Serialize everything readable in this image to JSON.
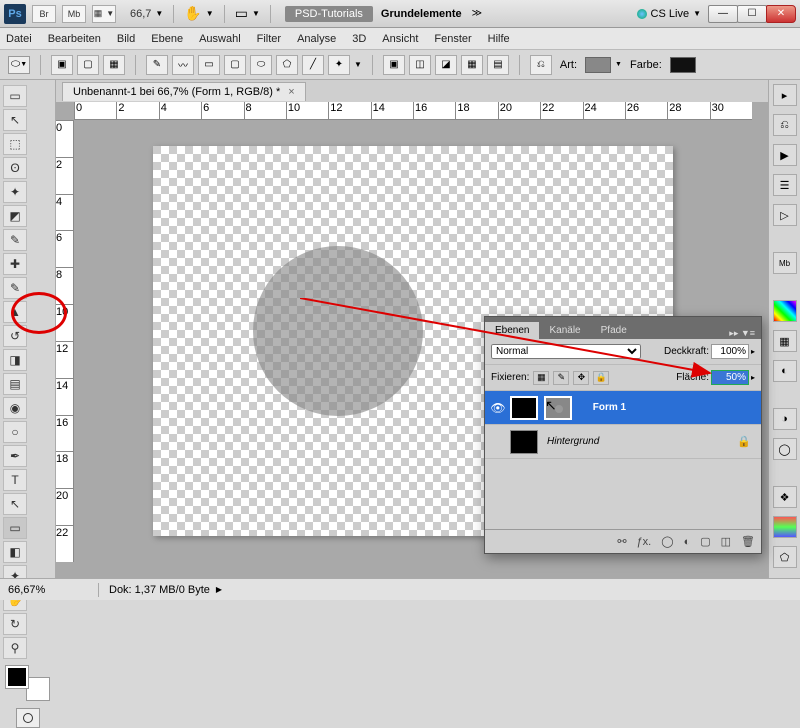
{
  "titlebar": {
    "logo": "Ps",
    "mini_buttons": [
      "Br",
      "Mb"
    ],
    "zoom": "66,7",
    "workspace_button": "PSD-Tutorials",
    "workspace_label": "Grundelemente",
    "cslive": "CS Live"
  },
  "menu": [
    "Datei",
    "Bearbeiten",
    "Bild",
    "Ebene",
    "Auswahl",
    "Filter",
    "Analyse",
    "3D",
    "Ansicht",
    "Fenster",
    "Hilfe"
  ],
  "options_bar": {
    "art_label": "Art:",
    "farbe_label": "Farbe:"
  },
  "document": {
    "tab_title": "Unbenannt-1 bei 66,7% (Form 1, RGB/8) *"
  },
  "ruler_h": [
    "0",
    "2",
    "4",
    "6",
    "8",
    "10",
    "12",
    "14",
    "16",
    "18",
    "20",
    "22",
    "24",
    "26",
    "28",
    "30"
  ],
  "ruler_v": [
    "0",
    "2",
    "4",
    "6",
    "8",
    "10",
    "12",
    "14",
    "16",
    "18",
    "20",
    "22"
  ],
  "layers_panel": {
    "tabs": [
      "Ebenen",
      "Kanäle",
      "Pfade"
    ],
    "blend_mode": "Normal",
    "deckkraft_label": "Deckkraft:",
    "deckkraft_value": "100%",
    "fixieren_label": "Fixieren:",
    "flaeche_label": "Fläche:",
    "flaeche_value": "50%",
    "layers": [
      {
        "name": "Form 1",
        "visible": true,
        "selected": true
      },
      {
        "name": "Hintergrund",
        "visible": false,
        "selected": false,
        "locked": true
      }
    ]
  },
  "statusbar": {
    "zoom": "66,67%",
    "doc_info": "Dok: 1,37 MB/0 Byte"
  },
  "tool_icons": [
    "▭",
    "↖",
    "▣",
    "✦",
    "◩",
    "✎",
    "✂",
    "✚",
    "◐",
    "▱",
    "✎",
    "◆",
    "◨",
    "✐",
    "△",
    "◉",
    "◇",
    "✎",
    "✐",
    "T",
    "✎",
    "▭",
    "◧",
    "✎",
    "▤",
    "✋",
    "◷",
    "⚲"
  ]
}
